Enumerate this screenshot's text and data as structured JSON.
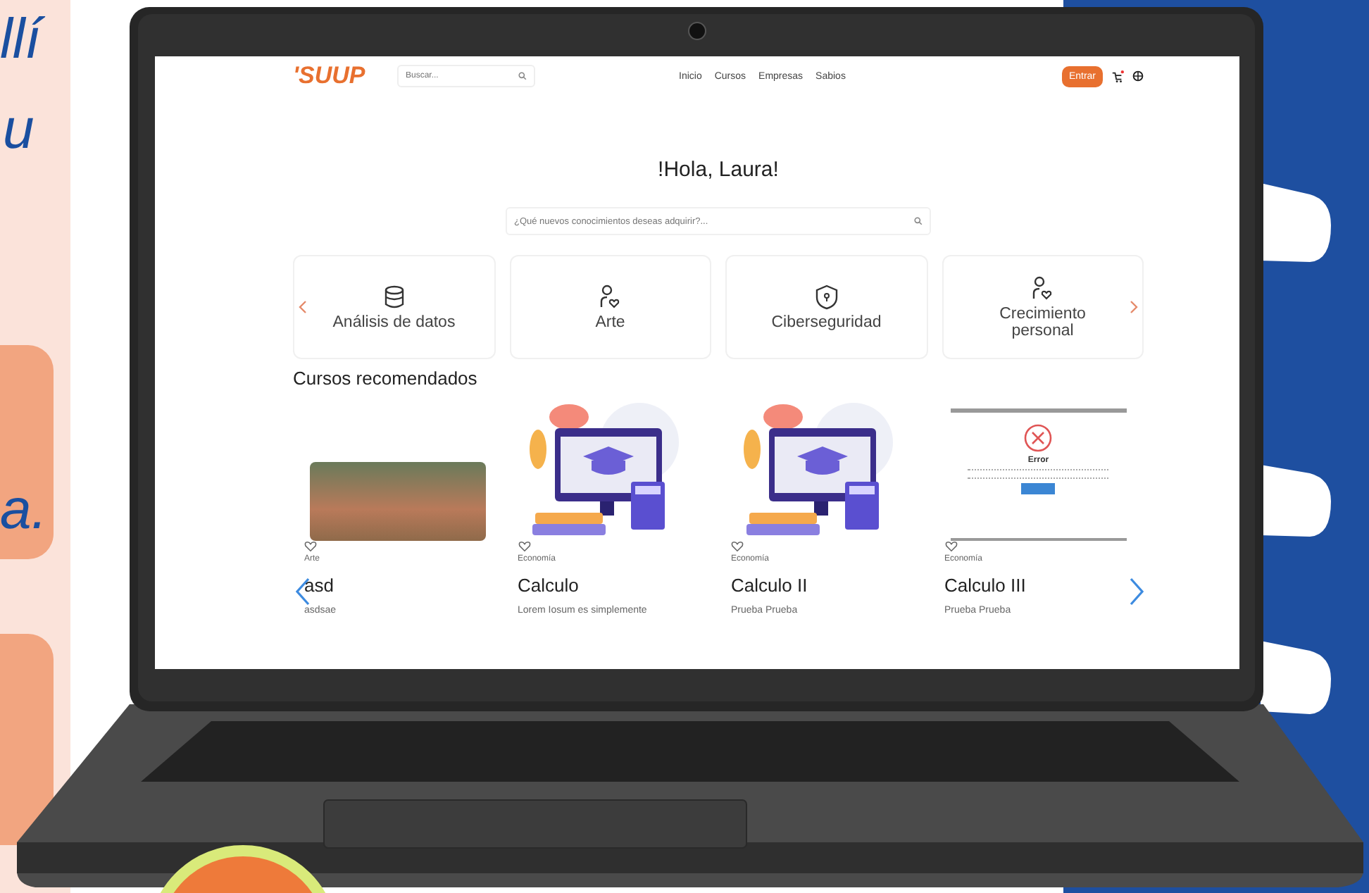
{
  "background": {
    "texts": [
      "llí",
      "u",
      "a."
    ]
  },
  "header": {
    "logo": "'SUUP",
    "search": {
      "placeholder": "Buscar..."
    },
    "nav": [
      "Inicio",
      "Cursos",
      "Empresas",
      "Sabios"
    ],
    "login_button": "Entrar"
  },
  "greeting": "!Hola, Laura!",
  "main_search": {
    "placeholder": "¿Qué nuevos conocimientos deseas adquirir?..."
  },
  "categories": [
    {
      "label": "Análisis de datos",
      "kind": "database"
    },
    {
      "label": "Arte",
      "kind": "person"
    },
    {
      "label": "Ciberseguridad",
      "kind": "shield"
    },
    {
      "label": "Crecimiento personal",
      "kind": "person"
    }
  ],
  "section_title": "Cursos recomendados",
  "courses": [
    {
      "kind": "photo",
      "category": "Arte",
      "title": "asd",
      "description": "asdsae"
    },
    {
      "kind": "illustration",
      "category": "Economía",
      "title": "Calculo",
      "description": "Lorem Iosum es simplemente"
    },
    {
      "kind": "illustration",
      "category": "Economía",
      "title": "Calculo II",
      "description": "Prueba Prueba"
    },
    {
      "kind": "dialog",
      "dialog_title": "Error",
      "category": "Economía",
      "title": "Calculo III",
      "description": "Prueba Prueba"
    }
  ]
}
